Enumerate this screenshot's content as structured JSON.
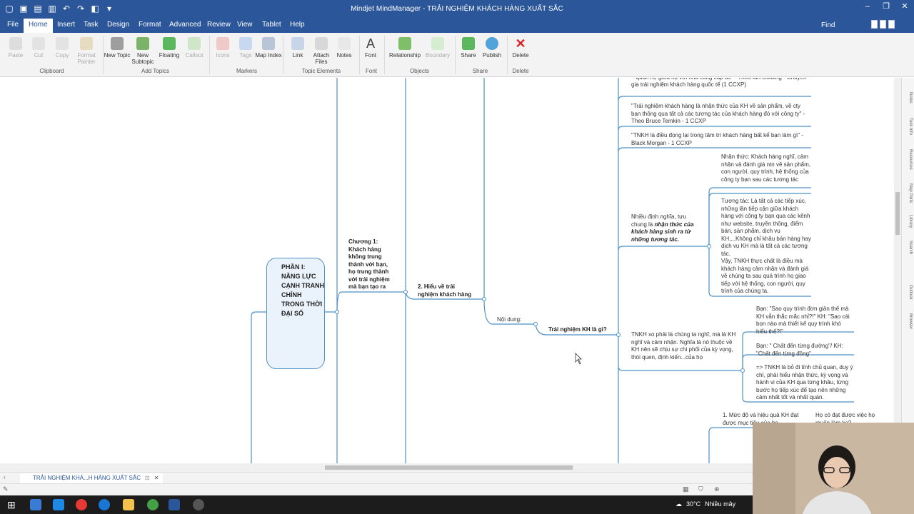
{
  "window": {
    "title": "Mindjet MindManager - TRẢI NGHIỆM KHÁCH HÀNG XUẤT SẮC"
  },
  "menu": {
    "tabs": [
      "File",
      "Home",
      "Insert",
      "Task",
      "Design",
      "Format",
      "Advanced",
      "Review",
      "View",
      "Tablet",
      "Help"
    ],
    "active": "Home",
    "find_label": "Find"
  },
  "ribbon": {
    "buttons": {
      "paste": "Paste",
      "cut": "Cut",
      "copy": "Copy",
      "format_painter": "Format Painter",
      "new_topic": "New Topic",
      "new_subtopic": "New Subtopic",
      "floating": "Floating",
      "callout": "Callout",
      "icons": "Icons",
      "tags": "Tags",
      "map_index": "Map Index",
      "link": "Link",
      "attach_files": "Attach Files",
      "notes": "Notes",
      "font": "Font",
      "relationship": "Relationship",
      "boundary": "Boundary",
      "share": "Share",
      "publish": "Publish",
      "delete": "Delete"
    },
    "groups": {
      "clipboard": "Clipboard",
      "add_topics": "Add Topics",
      "markers": "Markers",
      "topic_elements": "Topic Elements",
      "font": "Font",
      "objects": "Objects",
      "share": "Share",
      "delete": "Delete"
    }
  },
  "map": {
    "root": "PHẦN I: NĂNG LỰC CẠNH TRANH CHÍNH TRONG THỜI ĐẠI SỐ",
    "chapter1": "Chương 1: Khách hàng không trung thành với bạn, họ trung thành với trải nghiệm mà bạn tạo ra",
    "section2": "2. Hiểu về trải nghiệm khách hàng",
    "content_label": "Nội dung:",
    "question": "Trải nghiệm KH là gì?",
    "quote_top": "khách hàng và tất cả các tương tác giữa khách hàng và thương hiệu – quan hệ giữa họ với nhà cung cấp đó\" - Theo Ian Golding - Chuyên gia trải nghiệm khách hàng quốc tế (1 CCXP)",
    "quote_temkin": "\"Trải nghiệm khách hàng là nhận thức của KH về sản phẩm, về cty bạn thông qua tất cả các tương tác của khách hàng đó với công ty\" - Theo Bruce Temkin - 1 CCXP",
    "quote_morgan": "\"TNKH là điều đọng lại trong tâm trí khách hàng bất kể bạn làm gì\" - Black Morgan - 1 CCXP",
    "many_defs_prefix": "Nhiều định nghĩa, tựu chung là ",
    "many_defs_bold": "nhận thức của khách hàng sinh ra từ những tương tác.",
    "perception": "Nhận thức: Khách hàng nghĩ, cảm nhận và đánh giá ntn về sản phẩm, con người, quy trình, hệ thống của công ty bạn sau các tương tác",
    "interaction": "Tương tác: Là tất cả các tiếp xúc, những lần tiếp cận giữa khách hàng với công ty bạn qua các kênh như website, truyền thông, điểm bán, sản phẩm, dịch vụ KH,...Không chỉ khâu bán hàng hay dịch vụ KH mà là tất cả các tương tác.",
    "so_tnkh": "Vậy, TNKH thực chất là điều mà khách hàng cảm nhận và đánh giá về chúng ta sau quá trình họ giao tiếp với hệ thống, con người, quy trình của chúng ta.",
    "tnkh_is": "TNKH xo phải là chúng ta nghĩ, mà là KH nghĩ và cảm nhận. Nghĩa là nó thuộc về KH nên sẽ chịu sự chi phối của kỳ vọng, thói quen, định kiến...của họ",
    "dialog1": "Bạn: \"Sao quy trình đơn giản thế mà KH vẫn thắc mắc nhỉ?!\" KH: \"Sao cái bọn nào mà thiết kế quy trình khó hiểu thế?!\"",
    "dialog2": "Bạn: \" Chất đến từng đường\"/ KH: \"Chất đến từng đồng\"",
    "conclusion": "=> TNKH là bỏ đi tính chủ quan, duy ý chí, phải hiểu nhận thức, kỳ vọng và hành vi của KH qua từng khâu, từng bước họ tiếp xúc để tạo nên những cảm nhất tốt và nhất quán.",
    "level1": "1. Mức độ và hiệu quả KH đạt được mục tiêu của họ",
    "level_side": "Họ có đạt được việc họ muốn làm ko?"
  },
  "sidebar_tabs": [
    "Notes",
    "Task Info",
    "Resources",
    "Map Parts",
    "Library",
    "Search",
    "Outlook",
    "Browser"
  ],
  "doc_tab": {
    "label": "TRẢI NGHIỆM KHÁ...H HÀNG XUẤT SẮC"
  },
  "taskbar": {
    "temperature": "30°C",
    "weather": "Nhiều mây"
  },
  "colors": {
    "accent": "#2b579a",
    "branch": "#4e90c8"
  }
}
